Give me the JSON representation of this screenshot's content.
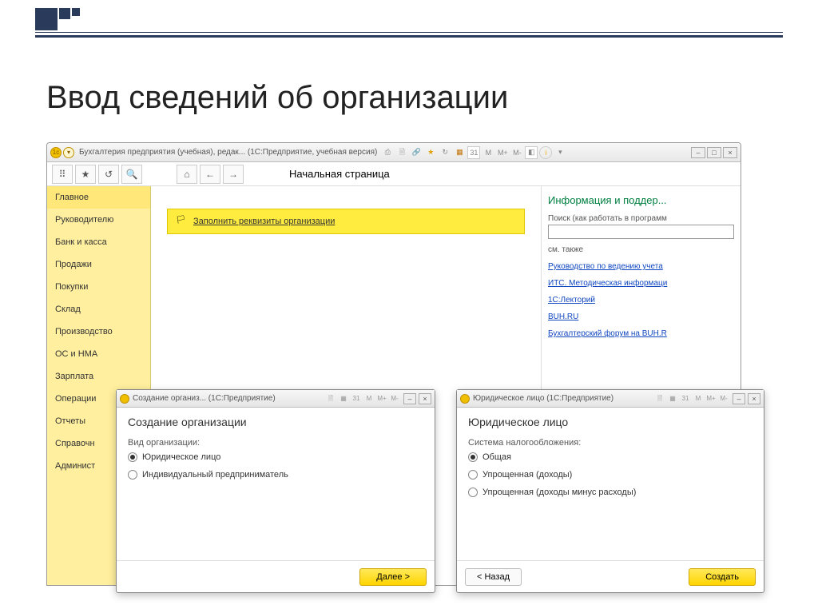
{
  "slide_title": "Ввод сведений об организации",
  "main_window": {
    "title": "Бухгалтерия предприятия (учебная), редак...  (1С:Предприятие, учебная версия)",
    "memory_labels": {
      "m": "M",
      "mplus": "M+",
      "mminus": "M-"
    },
    "toolbar": {
      "page_title": "Начальная страница"
    },
    "sidebar": {
      "items": [
        "Главное",
        "Руководителю",
        "Банк и касса",
        "Продажи",
        "Покупки",
        "Склад",
        "Производство",
        "ОС и НМА",
        "Зарплата",
        "Операции",
        "Отчеты",
        "Справочн",
        "Админист"
      ]
    },
    "banner": {
      "link": "Заполнить реквизиты организации"
    },
    "right_panel": {
      "heading": "Информация и поддер...",
      "search_label": "Поиск (как работать в программ",
      "see_also": "см. также",
      "links": [
        "Руководство по ведению учета",
        "ИТС. Методическая информаци",
        "1С:Лекторий",
        "BUH.RU",
        "Бухгалтерский форум на BUH.R"
      ]
    }
  },
  "dialog1": {
    "titlebar": "Создание организ... (1С:Предприятие)",
    "heading": "Создание организации",
    "field_label": "Вид организации:",
    "options": [
      "Юридическое лицо",
      "Индивидуальный предприниматель"
    ],
    "next_btn": "Далее >"
  },
  "dialog2": {
    "titlebar": "Юридическое лицо (1С:Предприятие)",
    "heading": "Юридическое лицо",
    "field_label": "Система налогообложения:",
    "options": [
      "Общая",
      "Упрощенная (доходы)",
      "Упрощенная (доходы минус расходы)"
    ],
    "back_btn": "< Назад",
    "create_btn": "Создать"
  }
}
